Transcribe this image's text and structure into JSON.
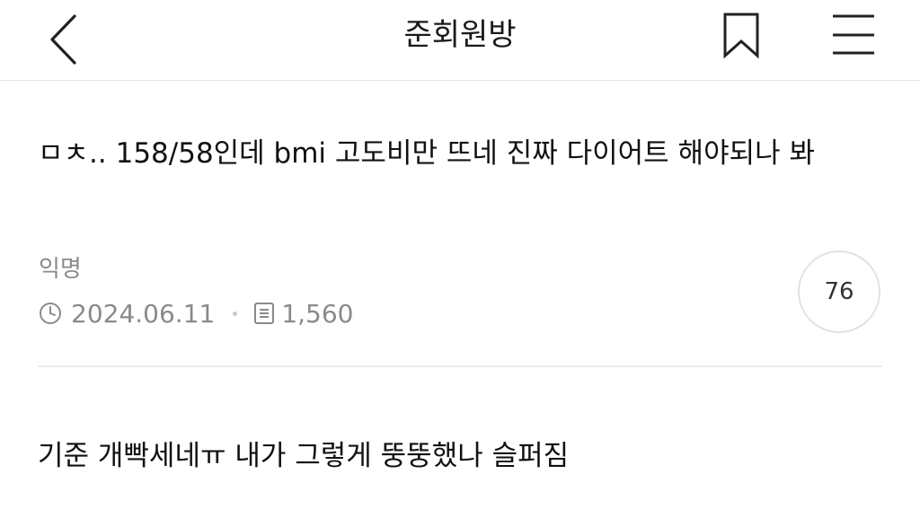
{
  "header": {
    "title": "준회원방",
    "back_icon": "chevron-left-icon",
    "bookmark_icon": "bookmark-icon",
    "menu_icon": "hamburger-menu-icon"
  },
  "post": {
    "title": "ㅁㅊ.. 158/58인데 bmi 고도비만 뜨네 진짜 다이어트 해야되나 봐",
    "author": "익명",
    "date": "2024.06.11",
    "views": "1,560",
    "comment_count": "76",
    "body": "기준 개빡세네ㅠ 내가 그렇게 뚱뚱했나 슬퍼짐"
  },
  "colors": {
    "text": "#111111",
    "meta": "#8a8a8a",
    "divider": "#ececec",
    "circle_border": "#e2e2e2"
  }
}
